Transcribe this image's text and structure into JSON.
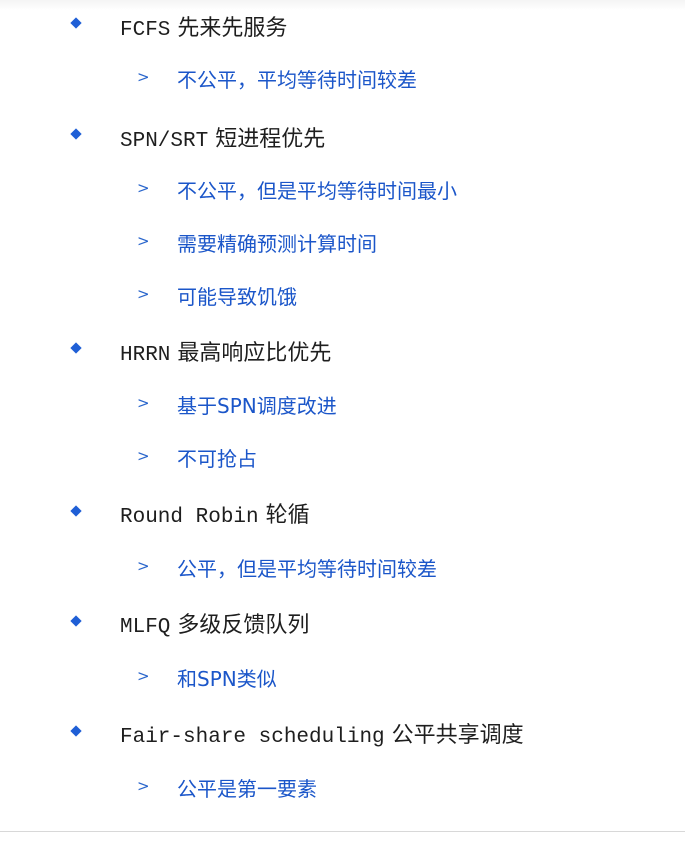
{
  "items": [
    {
      "code": "FCFS",
      "label": "先来先服务",
      "subs": [
        "不公平，平均等待时间较差"
      ]
    },
    {
      "code": "SPN/SRT",
      "label": "短进程优先",
      "subs": [
        "不公平，但是平均等待时间最小",
        "需要精确预测计算时间",
        "可能导致饥饿"
      ]
    },
    {
      "code": "HRRN",
      "label": "最高响应比优先",
      "subs": [
        "基于SPN调度改进",
        "不可抢占"
      ]
    },
    {
      "code": "Round Robin",
      "label": "轮循",
      "subs": [
        "公平，但是平均等待时间较差"
      ]
    },
    {
      "code": "MLFQ",
      "label": "多级反馈队列",
      "subs": [
        "和SPN类似"
      ]
    },
    {
      "code": "Fair-share scheduling",
      "label": "公平共享调度",
      "subs": [
        "公平是第一要素"
      ]
    }
  ],
  "colors": {
    "bullet": "#1f5fd6",
    "sub_text": "#1b56c9",
    "main_text": "#1e1e1e"
  },
  "icons": {
    "level1": "diamond-bullet-icon",
    "level2": "chevron-right-icon"
  }
}
